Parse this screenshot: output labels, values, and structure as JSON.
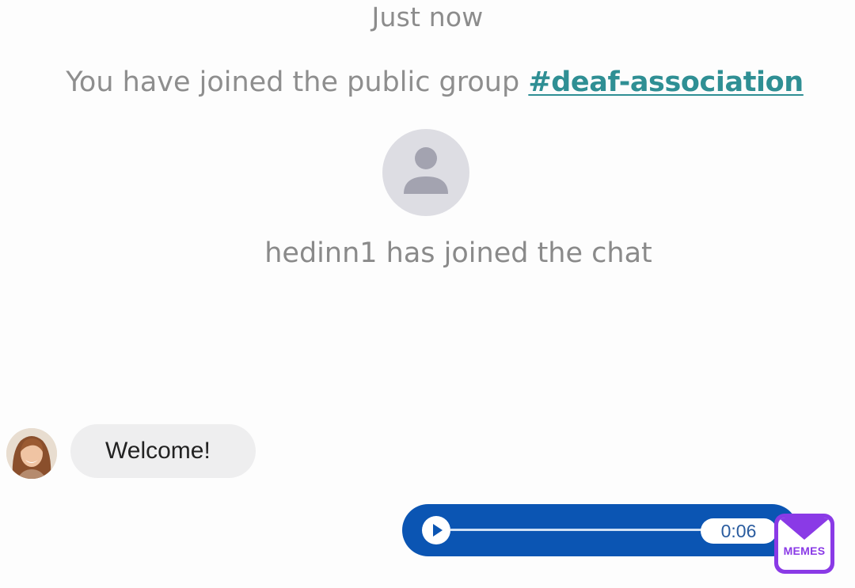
{
  "chat": {
    "timestamp": "Just now",
    "group_notice": {
      "prefix": "You have joined the public group ",
      "group_link": "#deaf-association"
    },
    "member_avatar_icon": "default-user-icon",
    "member_joined": "hedinn1 has joined the chat",
    "incoming_message": {
      "avatar": "user-photo",
      "text": "Welcome!"
    },
    "outgoing_audio": {
      "play_icon": "play-icon",
      "duration": "0:06",
      "colors": {
        "bubble": "#0b55b3",
        "track": "#cfe0f5"
      }
    }
  },
  "watermark": {
    "icon": "envelope-icon",
    "label": "MEMES",
    "color": "#8a3ae6"
  },
  "colors": {
    "background": "#fdfdfd",
    "system_text": "#8e8e8e",
    "link": "#2f8f94",
    "incoming_bubble": "#eeeeef"
  }
}
